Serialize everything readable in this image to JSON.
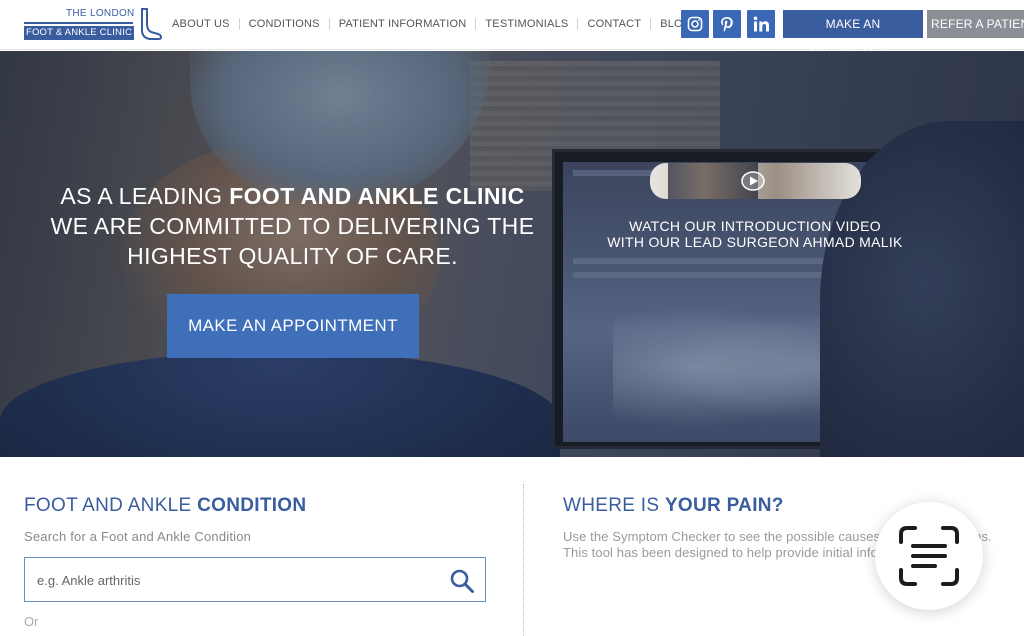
{
  "header": {
    "logo_line1": "THE LONDON",
    "logo_line2": "FOOT & ANKLE CLINIC",
    "nav": [
      {
        "label": "ABOUT US"
      },
      {
        "label": "CONDITIONS"
      },
      {
        "label": "PATIENT INFORMATION"
      },
      {
        "label": "TESTIMONIALS"
      },
      {
        "label": "CONTACT"
      },
      {
        "label": "BLOG"
      }
    ],
    "social": [
      {
        "icon": "instagram-icon"
      },
      {
        "icon": "pinterest-icon"
      },
      {
        "icon": "linkedin-icon"
      }
    ],
    "appointment_label": "MAKE AN APPOINTMENT",
    "refer_label": "REFER A PATIENT"
  },
  "hero": {
    "line1_pre": "AS A LEADING ",
    "line1_bold": "FOOT AND ANKLE CLINIC",
    "line2": "WE ARE COMMITTED TO DELIVERING THE",
    "line3": "HIGHEST QUALITY OF CARE.",
    "button_label": "MAKE AN APPOINTMENT",
    "video_line1": "WATCH OUR INTRODUCTION VIDEO",
    "video_line2": "WITH OUR LEAD SURGEON AHMAD MALIK"
  },
  "condition": {
    "title_pre": "FOOT AND ANKLE ",
    "title_bold": "CONDITION",
    "subtitle": "Search for a Foot and Ankle Condition",
    "search_placeholder": "e.g. Ankle arthritis",
    "or_label": "Or"
  },
  "pain": {
    "title_pre": "WHERE IS ",
    "title_bold": "YOUR PAIN?",
    "description": "Use the Symptom Checker to see the possible causes of your symptoms. This tool has been designed to help provide initial information only"
  },
  "colors": {
    "brand": "#3a5da0",
    "hero_button": "#3f6fb8",
    "refer_button": "#8a8f96"
  }
}
